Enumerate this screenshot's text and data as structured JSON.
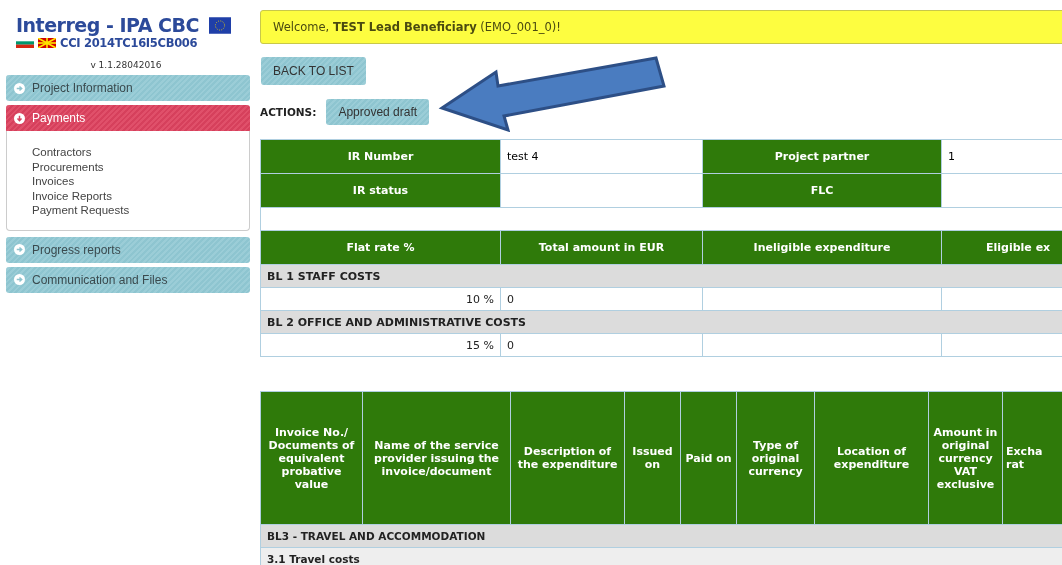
{
  "logo": {
    "title": "Interreg - IPA CBC",
    "code": "CCI 2014TC16I5CB006"
  },
  "version": "v 1.1.28042016",
  "sidebar": {
    "items": [
      {
        "label": "Project Information",
        "expanded": false
      },
      {
        "label": "Payments",
        "expanded": true,
        "children": [
          {
            "label": "Contractors"
          },
          {
            "label": "Procurements"
          },
          {
            "label": "Invoices"
          },
          {
            "label": "Invoice Reports"
          },
          {
            "label": "Payment Requests"
          }
        ]
      },
      {
        "label": "Progress reports",
        "expanded": false
      },
      {
        "label": "Communication and Files",
        "expanded": false
      }
    ]
  },
  "welcome": "Welcome, **TEST Lead Beneficiary** (EMO_001_0)!",
  "back_button": "BACK TO LIST",
  "actions": {
    "label": "ACTIONS:",
    "buttons": [
      "Approved draft"
    ]
  },
  "info_table": {
    "rows": [
      {
        "label_1": "IR Number",
        "value_1": "test 4",
        "label_2": "Project partner",
        "value_2": "1"
      },
      {
        "label_1": "IR status",
        "value_1": "",
        "label_2": "FLC",
        "value_2": ""
      }
    ]
  },
  "flat_table": {
    "columns": [
      "Flat rate %",
      "Total amount in EUR",
      "Ineligible expenditure",
      "Eligible ex"
    ],
    "sections": [
      {
        "title": "BL 1 STAFF COSTS",
        "rate": "10 %",
        "total": "0"
      },
      {
        "title": "BL 2 OFFICE AND ADMINISTRATIVE COSTS",
        "rate": "15 %",
        "total": "0"
      }
    ]
  },
  "invoice_table": {
    "columns": [
      "Invoice No./ Documents of equivalent probative value",
      "Name of the service provider issuing the invoice/document",
      "Description of the expenditure",
      "Issued on",
      "Paid on",
      "Type of original currency",
      "Location of expenditure",
      "Amount in original currency VAT exclusive",
      "Excha rat"
    ],
    "rows": [
      {
        "kind": "section",
        "text": "BL3 - TRAVEL AND ACCOMMODATION"
      },
      {
        "kind": "subsection",
        "text": "3.1 Travel costs"
      }
    ]
  }
}
